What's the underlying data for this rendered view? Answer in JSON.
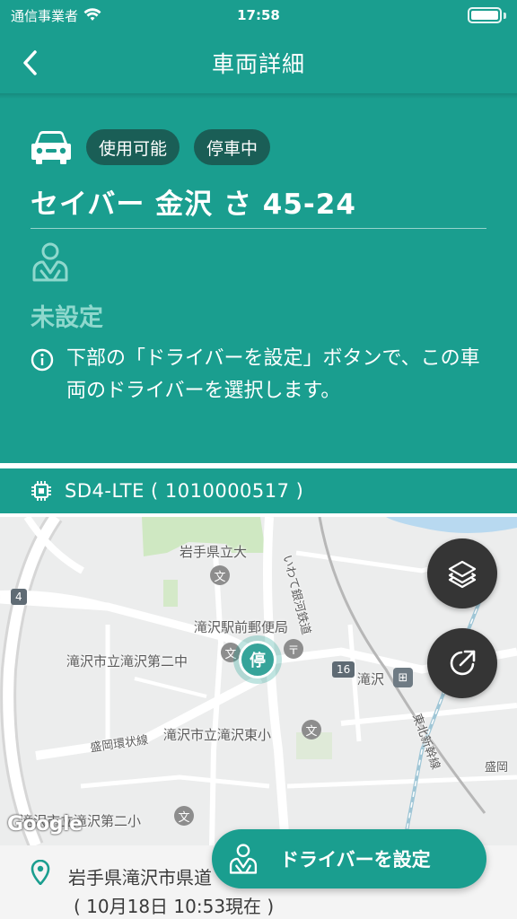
{
  "status_bar": {
    "carrier": "通信事業者",
    "time": "17:58"
  },
  "nav": {
    "title": "車両詳細",
    "back_icon": "chevron-left-icon"
  },
  "vehicle": {
    "badges": [
      "使用可能",
      "停車中"
    ],
    "name": "セイバー 金沢 さ 45-24",
    "driver_status": "未設定",
    "info_message": "下部の「ドライバーを設定」ボタンで、この車両のドライバーを選択します。"
  },
  "device": {
    "label": "SD4-LTE ( 1010000517 )"
  },
  "map": {
    "labels": {
      "iwate_univ": "岩手県立大",
      "post_office": "滝沢駅前郵便局",
      "junior_high": "滝沢市立滝沢第二中",
      "takizawa": "滝沢",
      "ring_road": "盛岡環状線",
      "elementary_east": "滝沢市立滝沢東小",
      "elementary_2": "滝沢市立滝沢第二小",
      "railway": "いわて銀河鉄道",
      "shinkansen": "東北新幹線",
      "morioka": "盛岡",
      "route_4": "4",
      "route_16": "16",
      "google": "Google"
    },
    "marker_label": "停"
  },
  "location": {
    "address": "岩手県滝沢市県道",
    "timestamp": "( 10月18日 10:53現在 )"
  },
  "actions": {
    "set_driver": "ドライバーを設定"
  },
  "colors": {
    "primary": "#1a9e8f",
    "badge_bg": "#1a5e56",
    "muted_teal": "#8fd8cd",
    "fab_bg": "#353535"
  }
}
